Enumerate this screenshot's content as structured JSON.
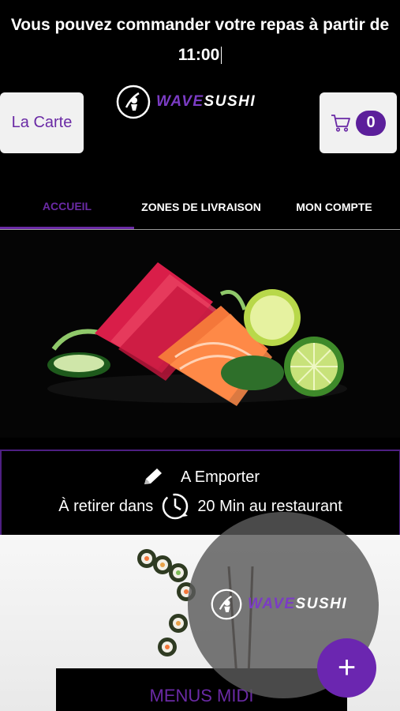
{
  "announcement": {
    "line1": "Vous pouvez commander votre repas à partir de",
    "time": "11:00"
  },
  "header": {
    "carte_label": "La Carte",
    "cart_count": "0",
    "logo": {
      "wave": "WAVE",
      "sushi": "SUSHI"
    }
  },
  "tabs": [
    {
      "label": "ACCUEIL",
      "active": true
    },
    {
      "label": "ZONES DE LIVRAISON",
      "active": false
    },
    {
      "label": "MON COMPTE",
      "active": false
    }
  ],
  "mode": {
    "title": "A Emporter",
    "pickup_prefix": "À retirer dans",
    "pickup_suffix": "20 Min au restaurant"
  },
  "promo": {
    "button_label": "MENUS MIDI"
  },
  "overlay_logo": {
    "wave": "WAVE",
    "sushi": "SUSHI"
  },
  "fab": {
    "icon": "plus-icon",
    "label": "+"
  },
  "colors": {
    "accent": "#6a2aa5",
    "badge": "#5c1f9b",
    "fab": "#6b26b0",
    "background": "#000000"
  }
}
